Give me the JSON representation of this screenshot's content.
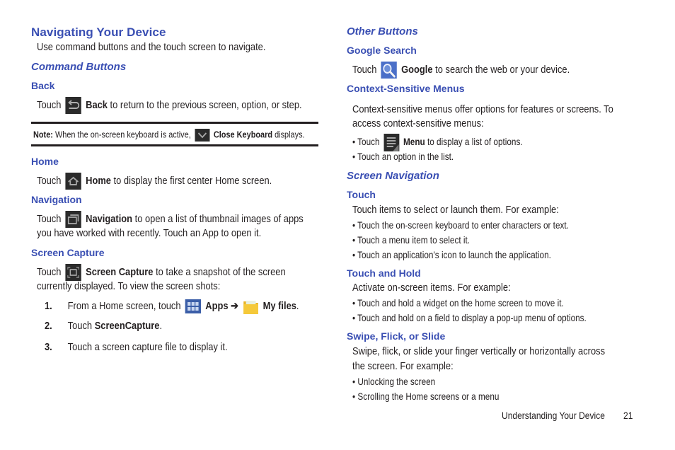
{
  "colors": {
    "heading": "#3a4fb3",
    "text": "#231f20",
    "icon_bg": "#2b2b2b",
    "apps_icon": "#3b5ea8",
    "folder": "#f2c230"
  },
  "left": {
    "title": "Navigating Your Device",
    "intro": "Use command buttons and the touch screen to navigate.",
    "command_buttons": "Command Buttons",
    "back": {
      "heading": "Back",
      "pre": "Touch",
      "bold": "Back",
      "post": "to return to the previous screen, option, or step."
    },
    "note": {
      "label": "Note:",
      "pre": "When the on-screen keyboard is active,",
      "bold": "Close Keyboard",
      "post": "displays."
    },
    "home": {
      "heading": "Home",
      "pre": "Touch",
      "bold": "Home",
      "post": "to display the first center Home screen."
    },
    "navigation": {
      "heading": "Navigation",
      "pre": "Touch",
      "bold": "Navigation",
      "post": "to open a list of thumbnail images of apps",
      "line2": "you have worked with recently. Touch an App to open it."
    },
    "screen_capture": {
      "heading": "Screen Capture",
      "pre": "Touch",
      "bold": "Screen Capture",
      "post": "to take a snapshot of the screen",
      "line2": "currently displayed. To view the screen shots:",
      "steps": [
        {
          "num": "1.",
          "pre": "From a Home screen, touch",
          "apps": "Apps",
          "arrow": "➔",
          "myfiles": "My files",
          "end": "."
        },
        {
          "num": "2.",
          "pre": "Touch",
          "bold": "ScreenCapture",
          "end": "."
        },
        {
          "num": "3.",
          "text": "Touch a screen capture file to display it."
        }
      ]
    }
  },
  "right": {
    "other_buttons": "Other Buttons",
    "google": {
      "heading": "Google Search",
      "pre": "Touch",
      "bold": "Google",
      "post": "to search the web or your device."
    },
    "context": {
      "heading": "Context-Sensitive Menus",
      "line1": "Context-sensitive menus offer options for features or screens. To",
      "line2": "access context-sensitive menus:",
      "bullet1_pre": "• Touch",
      "bullet1_bold": "Menu",
      "bullet1_post": "to display a list of options.",
      "bullet2": "• Touch an option in the list."
    },
    "screen_navigation": "Screen Navigation",
    "touch": {
      "heading": "Touch",
      "intro": "Touch items to select or launch them. For example:",
      "bullets": [
        "• Touch the on-screen keyboard to enter characters or text.",
        "• Touch a menu item to select it.",
        "• Touch an application’s icon to launch the application."
      ]
    },
    "touch_hold": {
      "heading": "Touch and Hold",
      "intro": "Activate on-screen items. For example:",
      "bullets": [
        "• Touch and hold a widget on the home screen to move it.",
        "• Touch and hold on a field to display a pop-up menu of options."
      ]
    },
    "swipe": {
      "heading": "Swipe, Flick, or Slide",
      "line1": "Swipe, flick, or slide your finger vertically or horizontally across",
      "line2": "the screen. For example:",
      "bullets": [
        "• Unlocking the screen",
        "• Scrolling the Home screens or a menu"
      ]
    }
  },
  "footer": {
    "section": "Understanding Your Device",
    "page": "21"
  }
}
